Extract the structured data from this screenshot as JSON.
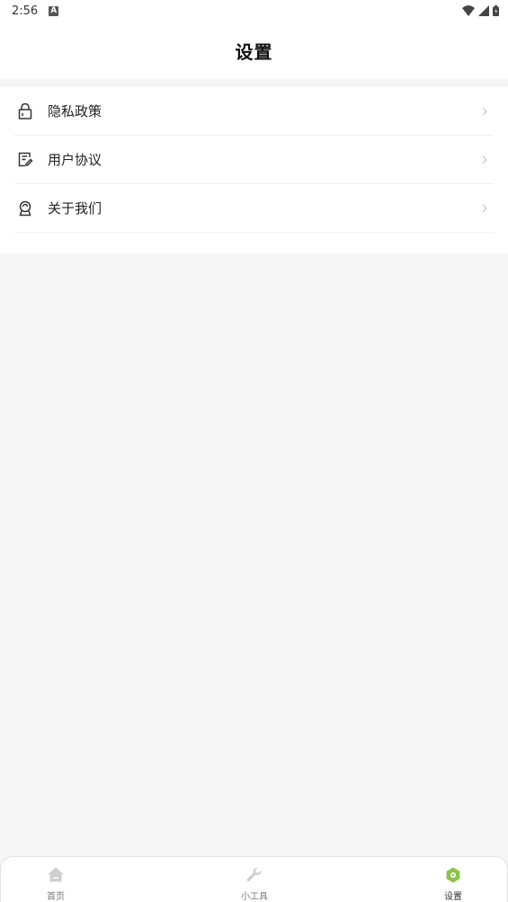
{
  "status_bar": {
    "time": "2:56",
    "notification_icon": "A",
    "icons": [
      "wifi-icon",
      "signal-icon",
      "battery-icon"
    ]
  },
  "header": {
    "title": "设置"
  },
  "menu": {
    "items": [
      {
        "label": "隐私政策",
        "icon": "lock-icon"
      },
      {
        "label": "用户协议",
        "icon": "document-edit-icon"
      },
      {
        "label": "关于我们",
        "icon": "badge-icon"
      }
    ]
  },
  "tabbar": {
    "active_color": "#8bc34a",
    "inactive_color": "#cccccc",
    "tabs": [
      {
        "label": "首页",
        "icon": "home-icon",
        "active": false
      },
      {
        "label": "小工具",
        "icon": "wrench-icon",
        "active": false
      },
      {
        "label": "设置",
        "icon": "gear-icon",
        "active": true
      }
    ]
  }
}
